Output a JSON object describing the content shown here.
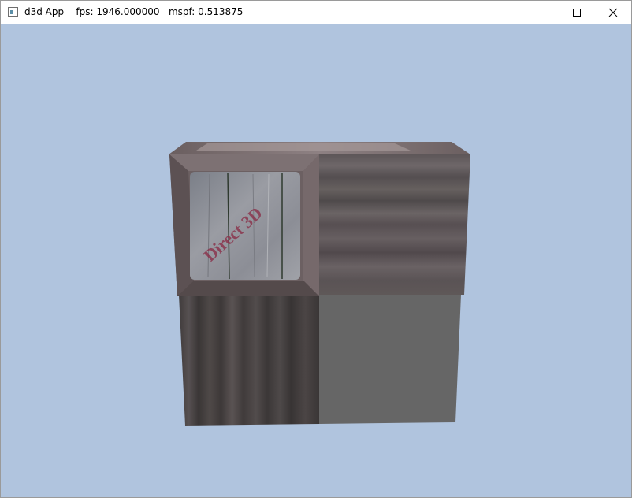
{
  "window": {
    "title": "d3d App    fps: 1946.000000   mspf: 0.513875",
    "clear_color": "#b0c4de"
  },
  "caption_buttons": {
    "minimize_icon": "minimize-icon",
    "maximize_icon": "maximize-icon",
    "close_icon": "close-icon"
  },
  "scene": {
    "crate_logo_text": "Direct 3D"
  }
}
